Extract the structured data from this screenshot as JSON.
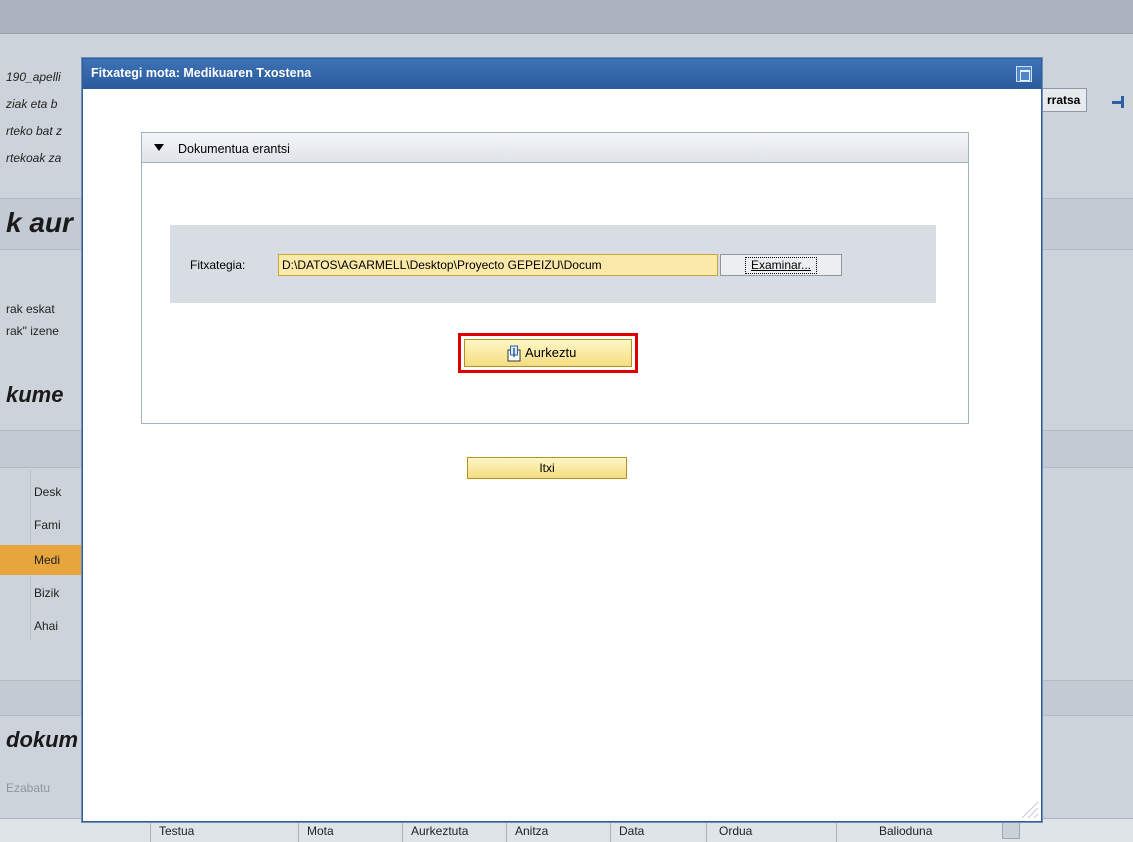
{
  "background": {
    "lines": [
      "190_apelli",
      "ziak eta b",
      "rteko bat z",
      "rtekoak za"
    ],
    "heading_large": "k aur",
    "text_lines": [
      "rak eskat",
      "rak\" izene"
    ],
    "heading_docs": "kume",
    "table_header": "Desk",
    "table_rows": [
      "Fami",
      "Medi",
      "Bizik",
      "Ahai"
    ],
    "heading_docs2": "dokum",
    "right_button": "rratsa",
    "delete_label": "Ezabatu",
    "footer_columns": [
      "Testua",
      "Mota",
      "Aurkeztuta",
      "Anitza",
      "Data",
      "Ordua",
      "Balioduna"
    ]
  },
  "modal": {
    "title": "Fitxategi mota: Medikuaren Txostena",
    "tray_title": "Dokumentua erantsi",
    "file_label": "Fitxategia:",
    "file_value": "D:\\DATOS\\AGARMELL\\Desktop\\Proyecto GEPEIZU\\Docum",
    "browse_label": "Examinar...",
    "submit_label": "Aurkeztu",
    "close_label": "Itxi"
  },
  "colors": {
    "title_bar": "#2f62a6",
    "button_yellow": "#f7e497",
    "highlight": "#e00000",
    "selected_row": "#e6a63d"
  }
}
